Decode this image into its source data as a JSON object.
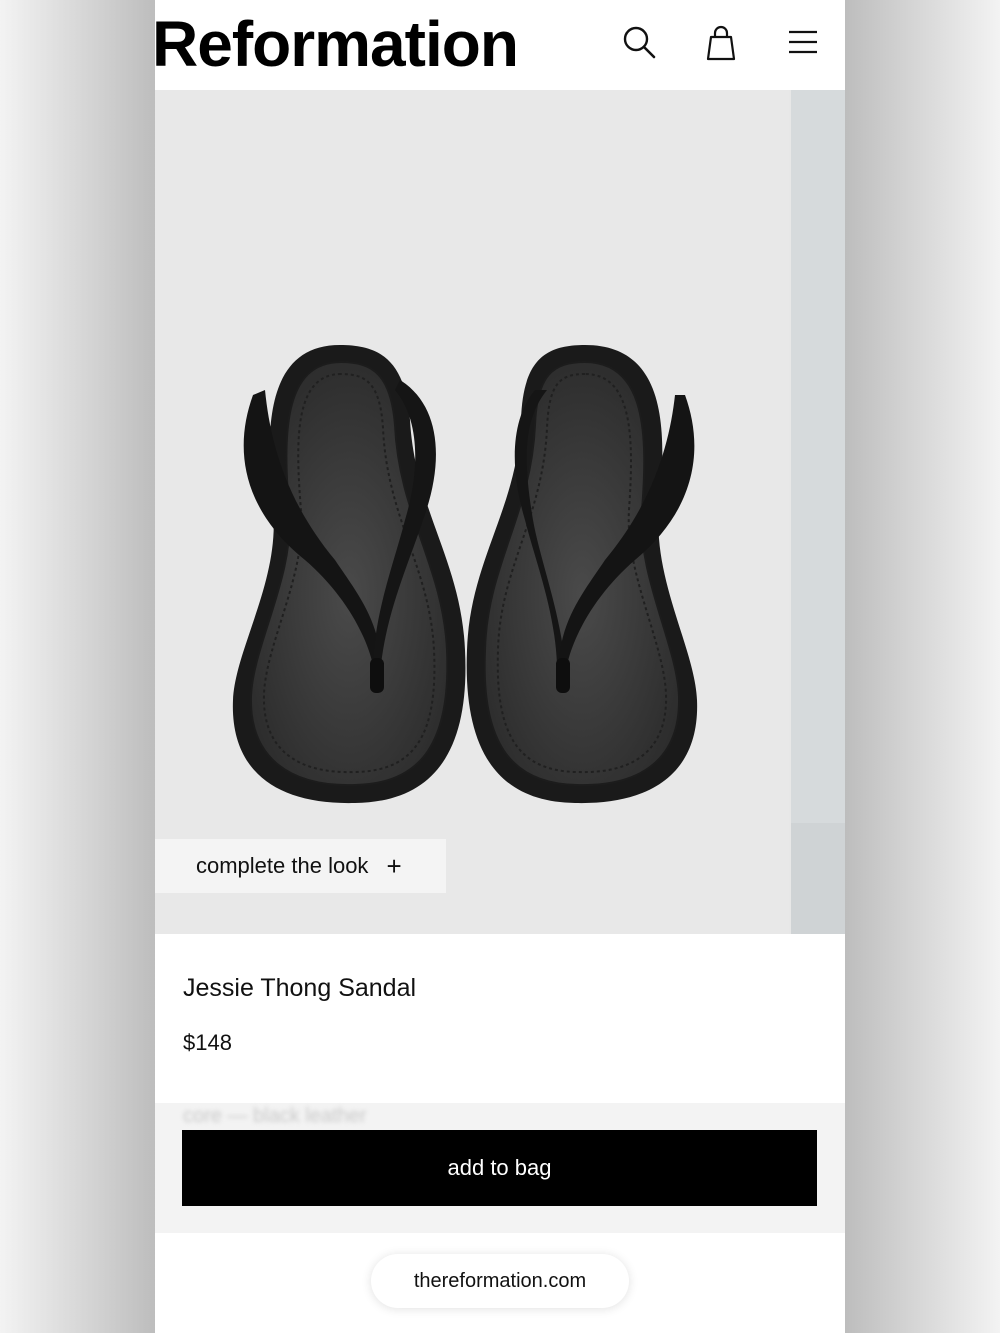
{
  "header": {
    "logo": "Reformation",
    "icons": [
      "search-icon",
      "bag-icon",
      "menu-icon"
    ]
  },
  "gallery": {
    "image_alt": "black leather thong sandals",
    "complete_the_look": {
      "label": "complete the look",
      "icon": "+"
    }
  },
  "product": {
    "name": "Jessie Thong Sandal",
    "price": "$148"
  },
  "sticky_bar": {
    "variant_hint": "core — black leather",
    "add_to_bag": "add to bag"
  },
  "browser": {
    "url": "thereformation.com"
  },
  "colors": {
    "primary": "#000000",
    "background": "#ffffff",
    "photo_bg": "#e8e8e8",
    "sandal": "#242424"
  }
}
